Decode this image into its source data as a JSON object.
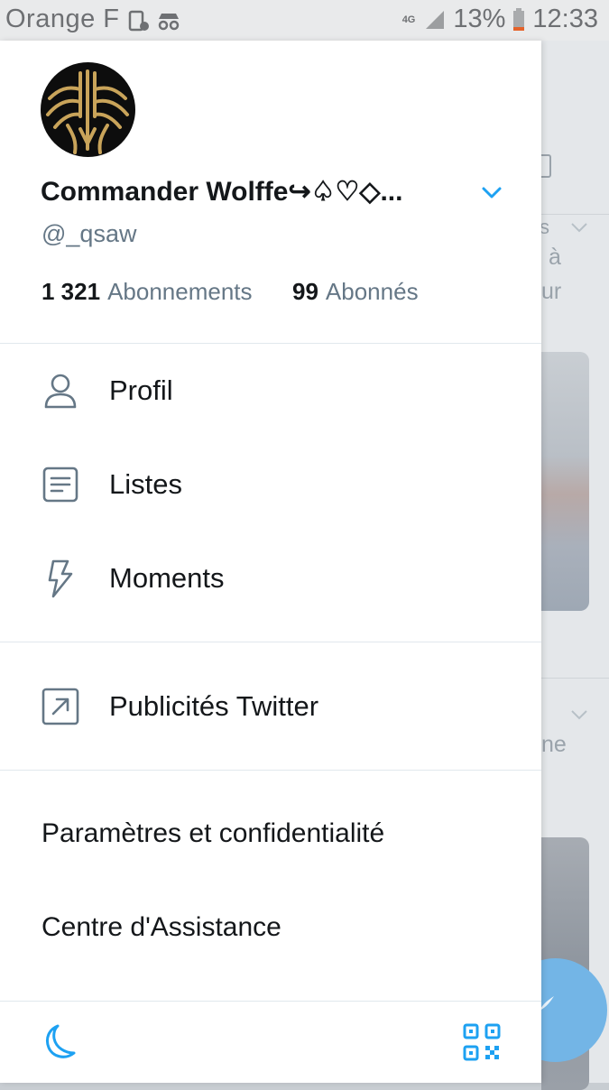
{
  "status_bar": {
    "carrier": "Orange F",
    "network": "4G",
    "battery": "13%",
    "time": "12:33"
  },
  "profile": {
    "display_name": "Commander Wolffe↪♤♡◇...",
    "handle": "@_qsaw",
    "following_count": "1 321",
    "following_label": "Abonnements",
    "followers_count": "99",
    "followers_label": "Abonnés"
  },
  "menu": {
    "items": [
      {
        "label": "Profil",
        "icon": "person-icon"
      },
      {
        "label": "Listes",
        "icon": "list-icon"
      },
      {
        "label": "Moments",
        "icon": "lightning-icon"
      }
    ],
    "ads": {
      "label": "Publicités Twitter",
      "icon": "external-link-icon"
    },
    "settings_label": "Paramètres et confidentialité",
    "help_label": "Centre d'Assistance"
  },
  "footer": {
    "night_mode_icon": "moon-icon",
    "qr_icon": "qr-code-icon"
  },
  "timeline_fragments": [
    "s",
    "à",
    "ur",
    "ne"
  ],
  "colors": {
    "accent": "#1da1f2",
    "text_primary": "#14171a",
    "text_secondary": "#657786",
    "icon_gray": "#657786"
  }
}
